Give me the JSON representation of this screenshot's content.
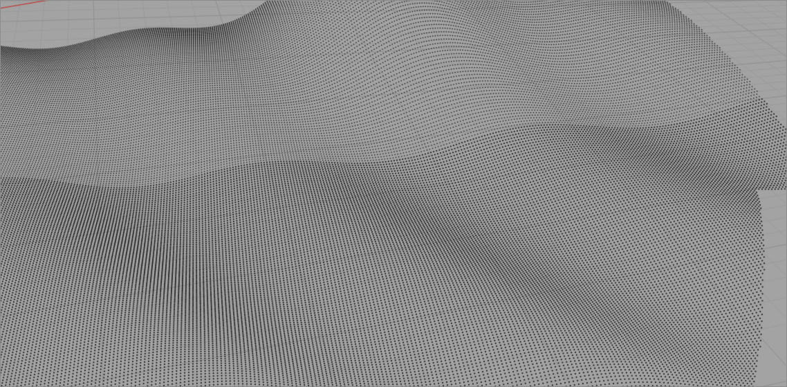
{
  "viewport": {
    "view_mode": "perspective",
    "display_mode": "point-cloud",
    "colors": {
      "background": "#a3a3a3",
      "grid_minor": "#9b9b9b",
      "grid_major": "#8f8f8f",
      "axis_x": "#c81e1e",
      "points": "#000000"
    }
  }
}
